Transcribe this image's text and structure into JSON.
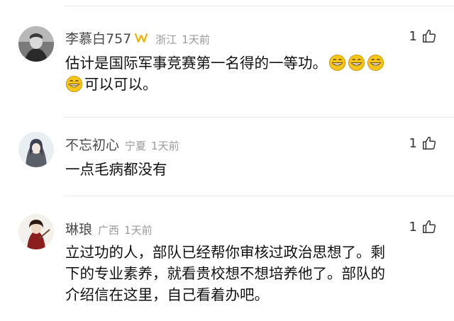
{
  "comments": [
    {
      "username": "李慕白757",
      "location": "浙江",
      "time": "1天前",
      "likes": "1",
      "line1": "估计是国际军事竞赛第一名得的一等功。",
      "line2": "可以可以。",
      "emoji": "grinning-face-emoji",
      "badge": "vip-badge-icon"
    },
    {
      "username": "不忘初心",
      "location": "宁夏",
      "time": "1天前",
      "likes": "1",
      "line1": "一点毛病都没有"
    },
    {
      "username": "琳琅",
      "location": "广西",
      "time": "1天前",
      "likes": "1",
      "line1": "立过功的人，部队已经帮你审核过政治思想了。剩",
      "line2": "下的专业素养，就看贵校想不想培养他了。部队的",
      "line3": "介绍信在这里，自己看着办吧。"
    }
  ],
  "colors": {
    "username": "#4a4a4a",
    "meta": "#9a9a9a",
    "text": "#111111",
    "badge": "#f0b400",
    "emoji": "#f5c518"
  }
}
